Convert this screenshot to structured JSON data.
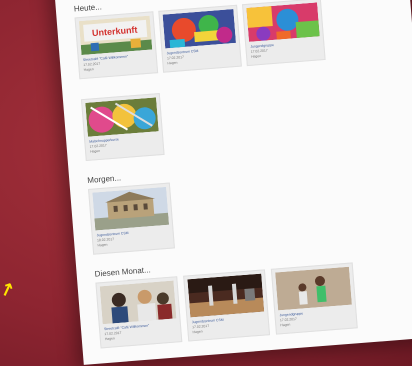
{
  "sections": [
    {
      "heading": "Heute...",
      "cards": [
        {
          "title": "Streetcafé \"Café Willkommen\"",
          "date": "17.02.2017",
          "place": "Hagen"
        },
        {
          "title": "Jugendzentrum CSM",
          "date": "17.02.2017",
          "place": "Hagen"
        },
        {
          "title": "Jungendgruppe",
          "date": "17.02.2017",
          "place": "Hagen"
        },
        {
          "title": "Malschnupperkurse",
          "date": "17.02.2017",
          "place": "Hagen"
        }
      ]
    },
    {
      "heading": "Morgen...",
      "cards": [
        {
          "title": "Jugendzentrum CSM",
          "date": "18.02.2017",
          "place": "Hagen"
        }
      ]
    },
    {
      "heading": "Diesen Monat...",
      "cards": [
        {
          "title": "Streetcafé \"Café Willkommen\"",
          "date": "17.02.2017",
          "place": "Hagen"
        },
        {
          "title": "Jugendzentrum CSM",
          "date": "17.02.2017",
          "place": "Hagen"
        },
        {
          "title": "Jungendgruppe",
          "date": "17.02.2017",
          "place": "Hagen"
        }
      ]
    }
  ],
  "thumb_texts": {
    "banner": "Unterkunft"
  },
  "icons": {
    "arrow": "arrow-icon"
  }
}
